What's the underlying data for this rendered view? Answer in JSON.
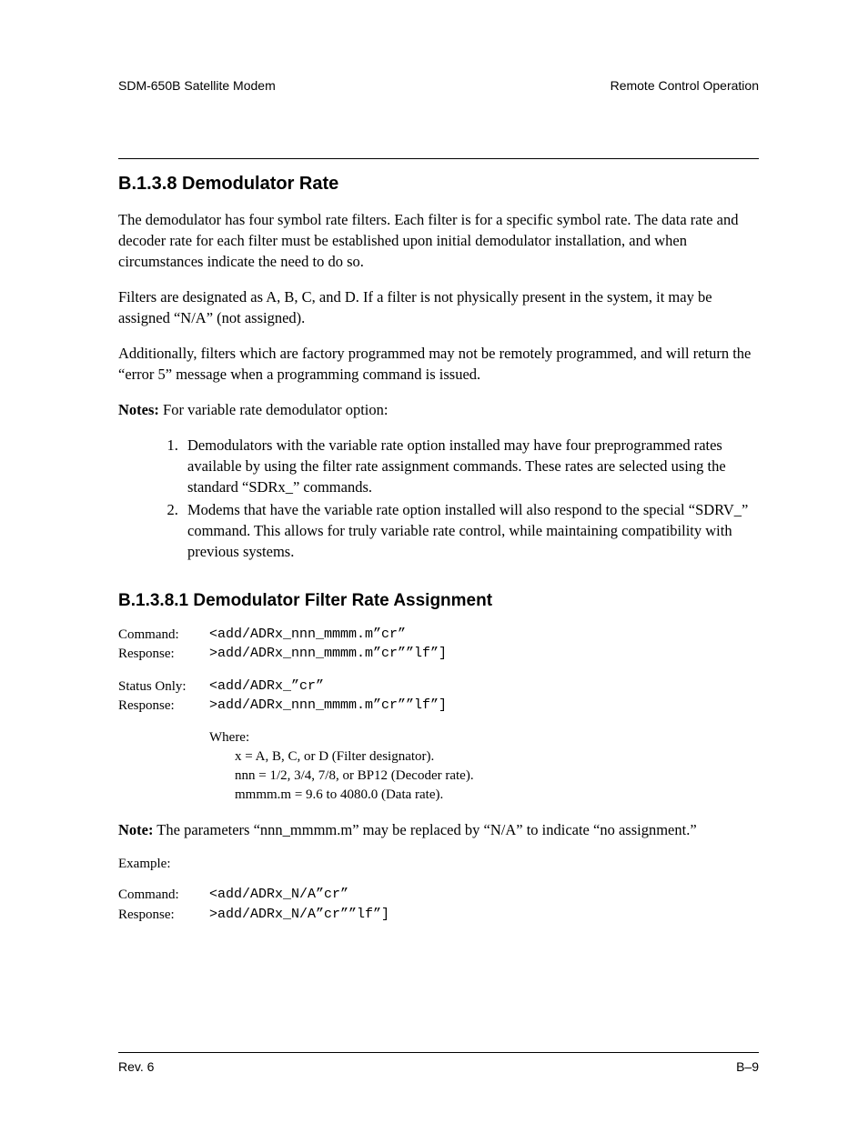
{
  "header": {
    "left": "SDM-650B Satellite Modem",
    "right": "Remote Control Operation"
  },
  "section1": {
    "heading": "B.1.3.8  Demodulator Rate",
    "para1": "The demodulator has four symbol rate filters. Each filter is for a specific symbol rate. The data rate and decoder rate for each filter must be established upon initial demodulator installation, and when circumstances indicate the need to do so.",
    "para2": "Filters are designated as A, B, C, and D. If a filter is not physically present in the system, it may be assigned “N/A” (not assigned).",
    "para3": "Additionally, filters which are factory programmed may not be remotely programmed, and will return the “error 5” message when a programming command is issued.",
    "notes_label": "Notes:",
    "notes_lead": " For variable rate demodulator option:",
    "note1": "Demodulators with the variable rate option installed may have four preprogrammed rates available by using the filter rate assignment commands. These rates are selected using the standard “SDRx_” commands.",
    "note2": "Modems that have the variable rate option installed will also respond to the special “SDRV_” command. This allows for truly variable rate control, while maintaining compatibility with previous systems."
  },
  "section2": {
    "heading": "B.1.3.8.1  Demodulator Filter Rate Assignment",
    "rows1": {
      "r1label": "Command:",
      "r1value": "<add/ADRx_nnn_mmmm.m”cr”",
      "r2label": "Response:",
      "r2value": ">add/ADRx_nnn_mmmm.m”cr””lf”]"
    },
    "rows2": {
      "r1label": "Status Only:",
      "r1value": "<add/ADRx_”cr”",
      "r2label": "Response:",
      "r2value": ">add/ADRx_nnn_mmmm.m”cr””lf”]"
    },
    "where": {
      "title": "Where:",
      "l1": "x = A, B, C, or D (Filter designator).",
      "l2": "nnn = 1/2, 3/4, 7/8, or BP12 (Decoder rate).",
      "l3": "mmmm.m = 9.6 to 4080.0 (Data rate)."
    },
    "note_label": "Note:",
    "note_text": " The parameters “nnn_mmmm.m” may be replaced by “N/A” to indicate “no assignment.”",
    "example_label": "Example:",
    "rows3": {
      "r1label": "Command:",
      "r1value": "<add/ADRx_N/A”cr”",
      "r2label": "Response:",
      "r2value": ">add/ADRx_N/A”cr””lf”]"
    }
  },
  "footer": {
    "left": "Rev. 6",
    "right": "B–9"
  }
}
